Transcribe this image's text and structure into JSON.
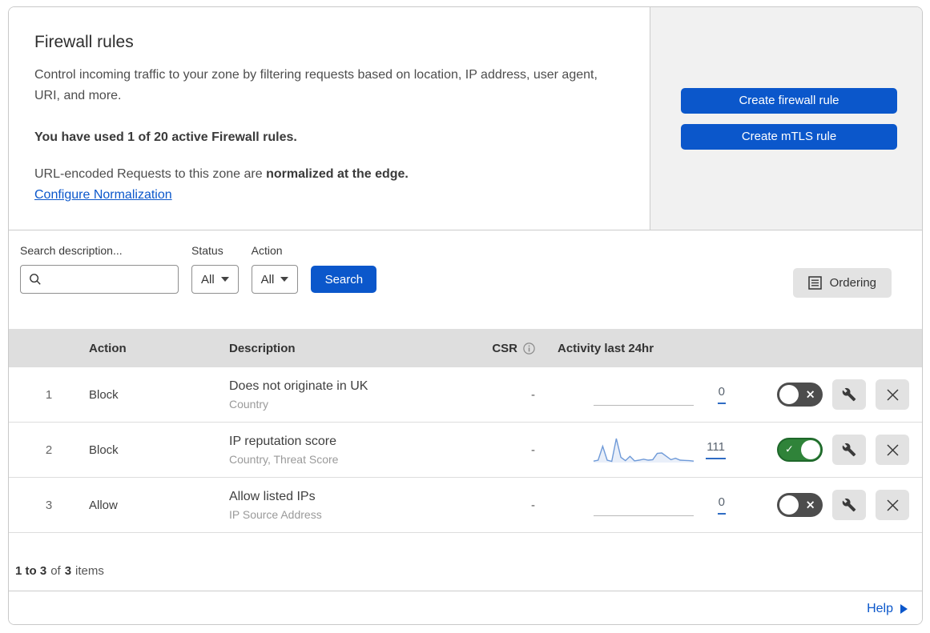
{
  "header": {
    "title": "Firewall rules",
    "description": "Control incoming traffic to your zone by filtering requests based on location, IP address, user agent, URI, and more.",
    "usage_line": "You have used 1 of 20 active Firewall rules.",
    "normalization_prefix": "URL-encoded Requests to this zone are ",
    "normalization_bold": "normalized at the edge.",
    "normalization_link": "Configure Normalization",
    "create_firewall_button": "Create firewall rule",
    "create_mtls_button": "Create mTLS rule"
  },
  "filters": {
    "search_label": "Search description...",
    "search_value": "",
    "status_label": "Status",
    "status_value": "All",
    "action_label": "Action",
    "action_value": "All",
    "search_button": "Search",
    "ordering_button": "Ordering"
  },
  "table": {
    "columns": {
      "action": "Action",
      "description": "Description",
      "csr": "CSR",
      "activity": "Activity last 24hr"
    },
    "rows": [
      {
        "index": "1",
        "action": "Block",
        "description": "Does not originate in UK",
        "criteria": "Country",
        "csr": "-",
        "activity_count": "0",
        "enabled": false,
        "sparkline": null
      },
      {
        "index": "2",
        "action": "Block",
        "description": "IP reputation score",
        "criteria": "Country, Threat Score",
        "csr": "-",
        "activity_count": "111",
        "enabled": true,
        "sparkline": {
          "type": "area",
          "x_range": "last 24hr",
          "values": [
            0.06,
            0.1,
            0.68,
            0.1,
            0.05,
            1.0,
            0.22,
            0.08,
            0.26,
            0.07,
            0.1,
            0.14,
            0.1,
            0.12,
            0.38,
            0.4,
            0.26,
            0.12,
            0.18,
            0.1,
            0.09,
            0.08,
            0.06
          ]
        }
      },
      {
        "index": "3",
        "action": "Allow",
        "description": "Allow listed IPs",
        "criteria": "IP Source Address",
        "csr": "-",
        "activity_count": "0",
        "enabled": false,
        "sparkline": null
      }
    ],
    "footer": {
      "range": "1 to 3",
      "of": "of",
      "total": "3",
      "items": "items"
    }
  },
  "help": {
    "label": "Help"
  },
  "icons": {
    "search": "magnifier",
    "caret_down": "filled-triangle-down",
    "ordering": "list-document",
    "info": "circled-i",
    "wrench": "spanner",
    "close": "x-cross",
    "help_arrow": "filled-triangle-right",
    "toggle_on_glyph": "✓",
    "toggle_off_glyph": "×"
  },
  "colors": {
    "accent_blue": "#0b57cb",
    "toggle_on_green": "#2f8339",
    "toggle_off_gray": "#4d4d4d",
    "sparkline_blue": "#6f9ad8",
    "sparkline_fill": "#e9eff9",
    "count_underline_blue": "#2f6cc4",
    "table_header_gray": "#dedede",
    "panel_gray": "#f1f1f1"
  }
}
